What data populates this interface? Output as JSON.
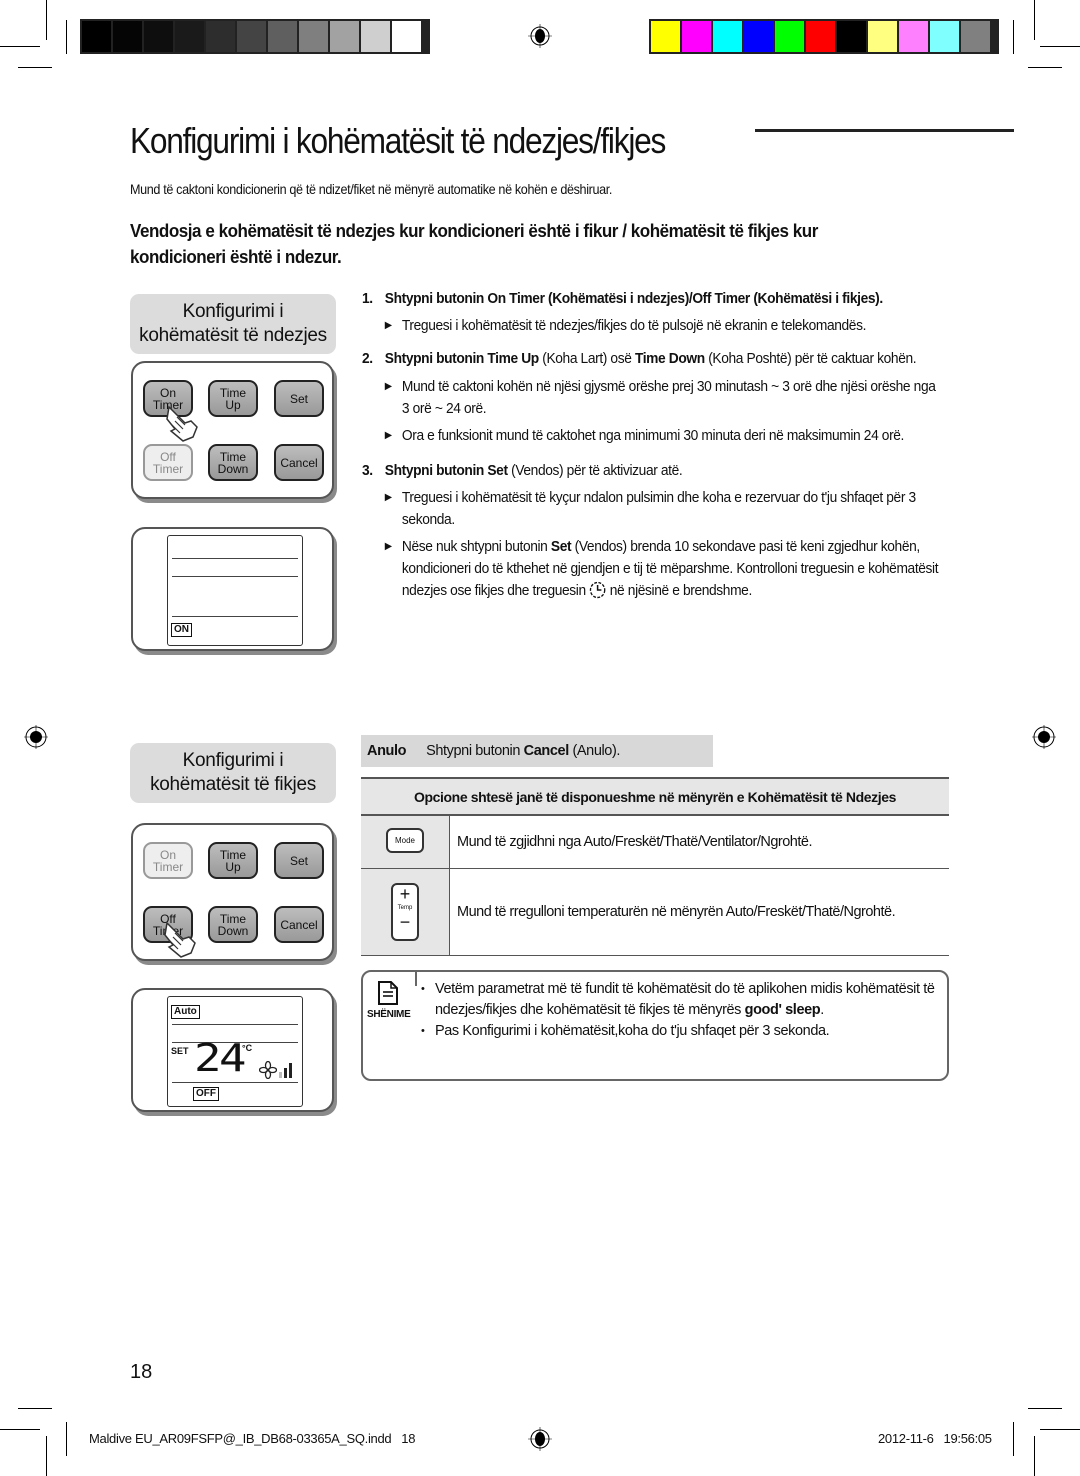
{
  "colors": {
    "grayscale_bar": [
      "#000000",
      "#050505",
      "#0e0e0e",
      "#1a1a1a",
      "#2d2d2d",
      "#444444",
      "#5f5f5f",
      "#7f7f7f",
      "#a2a2a2",
      "#cfcfcf",
      "#ffffff"
    ],
    "color_bar": [
      "#ffff00",
      "#ff00ff",
      "#00ffff",
      "#0000ff",
      "#00ff00",
      "#ff0000",
      "#000000",
      "#ffff80",
      "#ff80ff",
      "#80ffff",
      "#808080"
    ]
  },
  "page": {
    "title": "Konfigurimi i kohëmatësit të ndezjes/fikjes",
    "intro": "Mund të caktoni kondicionerin që të ndizet/fiket në mënyrë automatike në kohën e dëshiruar.",
    "subheading": "Vendosja e kohëmatësit të ndezjes kur kondicioneri është i fikur / kohëmatësit të fikjes kur kondicioneri është i ndezur.",
    "page_number": "18"
  },
  "panel_on": {
    "tag_line1": "Konfigurimi i",
    "tag_line2": "kohëmatësit të ndezjes",
    "buttons": {
      "on_timer": [
        "On",
        "Timer"
      ],
      "time_up": [
        "Time",
        "Up"
      ],
      "set": "Set",
      "off_timer": [
        "Off",
        "Timer"
      ],
      "time_down": [
        "Time",
        "Down"
      ],
      "cancel": "Cancel"
    },
    "pressed": "on_timer",
    "display_badge": "ON"
  },
  "panel_off": {
    "tag_line1": "Konfigurimi i",
    "tag_line2": "kohëmatësit të fikjes",
    "buttons": {
      "on_timer": [
        "On",
        "Timer"
      ],
      "time_up": [
        "Time",
        "Up"
      ],
      "set": "Set",
      "off_timer": [
        "Off",
        "Timer"
      ],
      "time_down": [
        "Time",
        "Down"
      ],
      "cancel": "Cancel"
    },
    "pressed": "off_timer",
    "display": {
      "mode_badge": "Auto",
      "set_label": "SET",
      "temperature": "24",
      "unit": "°C",
      "timer_badge": "OFF"
    }
  },
  "steps": [
    {
      "num": "1.",
      "text": "Shtypni butonin On Timer (Kohëmatësi i ndezjes)/Off Timer (Kohëmatësi i fikjes).",
      "bullets": [
        "Treguesi i kohëmatësit të ndezjes/fikjes do të pulsojë në ekranin e telekomandës."
      ]
    },
    {
      "num": "2.",
      "pre": "Shtypni butonin ",
      "b1": "Time Up",
      "m1": " (Koha Lart) osë ",
      "b2": "Time Down",
      "m2": " (Koha Poshtë) për të caktuar kohën.",
      "bullets": [
        "Mund të caktoni kohën në njësi gjysmë orëshe prej 30 minutash ~ 3 orë dhe njësi orëshe nga 3 orë ~ 24 orë.",
        "Ora e funksionit mund të caktohet nga minimumi 30 minuta deri në maksimumin 24 orë."
      ]
    },
    {
      "num": "3.",
      "pre": "Shtypni butonin ",
      "b1": "Set",
      "m1": " (Vendos) për të aktivizuar atë.",
      "bullets": [
        "Treguesi i kohëmatësit të kyçur ndalon pulsimin dhe koha e rezervuar do t'ju shfaqet për 3 sekonda."
      ],
      "bullet2": {
        "pre": "Nëse nuk shtypni butonin ",
        "bold": "Set",
        "mid": " (Vendos) brenda 10 sekondave pasi të keni zgjedhur kohën, kondicioneri do të kthehet në gjendjen e tij të mëparshme. Kontrolloni treguesin e kohëmatësit ndezjes ose fikjes dhe treguesin ",
        "icon": "timer-clock-icon",
        "post": " në njësinë e brendshme."
      }
    }
  ],
  "cancel_bar": {
    "label": "Anulo",
    "pre": "Shtypni butonin ",
    "bold": "Cancel",
    "post": " (Anulo)."
  },
  "options": {
    "header": "Opcione shtesë janë të disponueshme në mënyrën e Kohëmatësit të Ndezjes",
    "rows": [
      {
        "icon": "mode-button-icon",
        "icon_label": "Mode",
        "text": "Mund të zgjidhni nga Auto/Freskët/Thatë/Ventilator/Ngrohtë."
      },
      {
        "icon": "temp-button-icon",
        "icon_label": "Temp",
        "plus": "+",
        "minus": "−",
        "text": "Mund të rregulloni temperaturën në mënyrën Auto/Freskët/Thatë/Ngrohtë."
      }
    ]
  },
  "note": {
    "label": "SHËNIME",
    "items": [
      {
        "text": "Vetëm parametrat më të fundit të kohëmatësit do të aplikohen midis kohëmatësit të ndezjes/fikjes dhe kohëmatësit të fikjes të mënyrës ",
        "bold": "good' sleep",
        "post": "."
      },
      {
        "text": "Pas Konfigurimi i kohëmatësit,koha do t'ju shfaqet për 3 sekonda."
      }
    ]
  },
  "footer": {
    "file": "Maldive EU_AR09FSFP@_IB_DB68-03365A_SQ.indd   18",
    "timestamp": "2012-11-6   19:56:05"
  }
}
